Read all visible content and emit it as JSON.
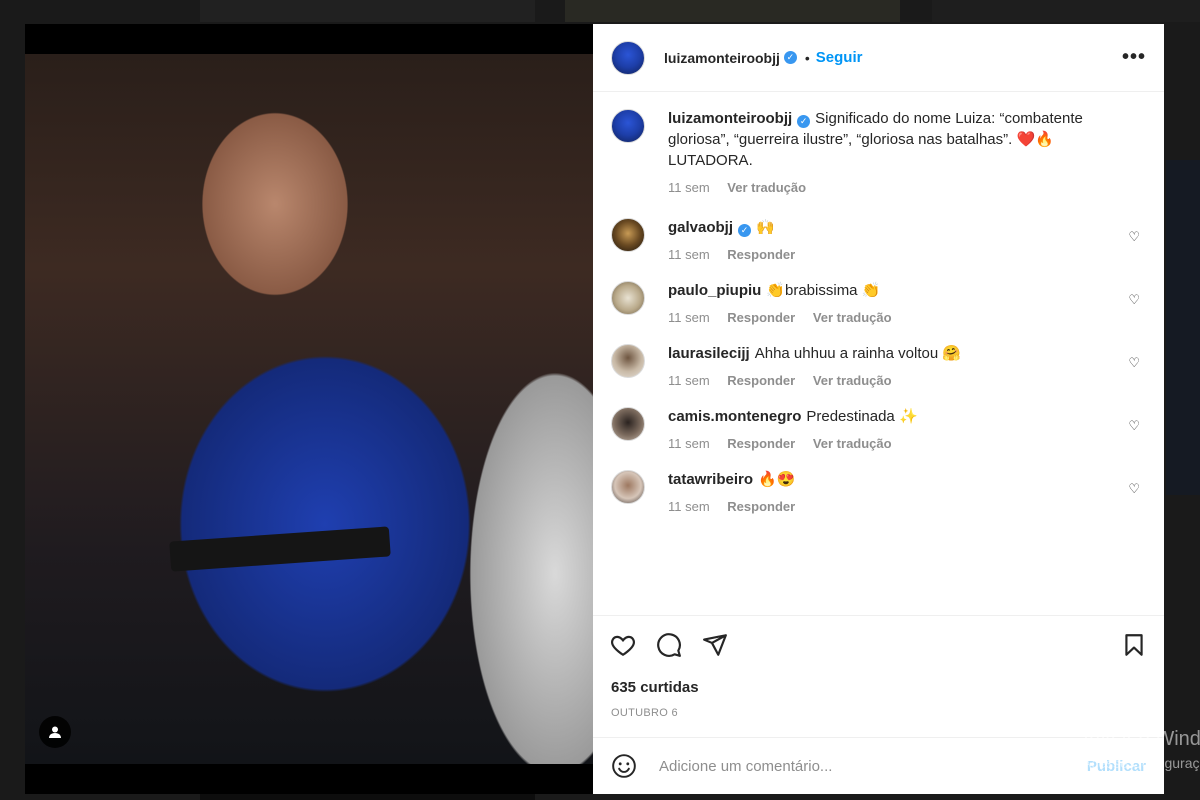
{
  "post": {
    "author": "luizamonteiroobjj",
    "follow_label": "Seguir",
    "separator": "•",
    "more_label": "•••",
    "caption": {
      "username": "luizamonteiroobjj",
      "text": "Significado do nome Luiza: “combatente gloriosa”, “guerreira ilustre”, “gloriosa nas batalhas”. ❤️🔥 LUTADORA.",
      "time": "11 sem",
      "translate": "Ver tradução"
    },
    "likes": "635 curtidas",
    "date": "OUTUBRO 6"
  },
  "comments": [
    {
      "username": "galvaobjj",
      "verified": true,
      "text": "🙌",
      "time": "11 sem",
      "reply": "Responder",
      "translate": ""
    },
    {
      "username": "paulo_piupiu",
      "verified": false,
      "text": "👏brabissima 👏",
      "time": "11 sem",
      "reply": "Responder",
      "translate": "Ver tradução"
    },
    {
      "username": "laurasilecijj",
      "verified": false,
      "text": "Ahha uhhuu a rainha voltou 🤗",
      "time": "11 sem",
      "reply": "Responder",
      "translate": "Ver tradução"
    },
    {
      "username": "camis.montenegro",
      "verified": false,
      "text": "Predestinada ✨",
      "time": "11 sem",
      "reply": "Responder",
      "translate": "Ver tradução"
    },
    {
      "username": "tatawribeiro",
      "verified": false,
      "text": "🔥😍",
      "time": "11 sem",
      "reply": "Responder",
      "translate": ""
    }
  ],
  "comment_box": {
    "placeholder": "Adicione um comentário...",
    "publish": "Publicar"
  },
  "watermark": {
    "line1": "Ativar o Windows",
    "line2": "Acesse Configurações"
  },
  "icons": {
    "like": "heart-icon",
    "comment": "comment-icon",
    "share": "share-icon",
    "save": "bookmark-icon",
    "emoji": "emoji-icon",
    "verified": "verified-badge-icon",
    "user_tag": "user-tag-icon"
  },
  "colors": {
    "accent": "#0095f6",
    "verified": "#3897f0",
    "text": "#262626",
    "muted": "#8e8e8e"
  }
}
